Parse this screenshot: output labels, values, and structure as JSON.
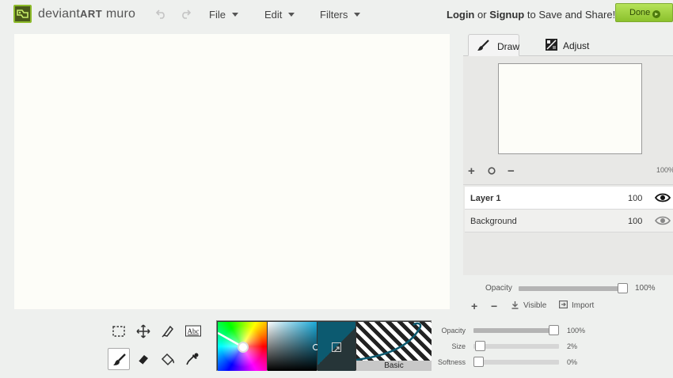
{
  "app": {
    "brand_regular": "deviant",
    "brand_bold": "ART",
    "brand_suffix": " muro"
  },
  "menu": {
    "file": "File",
    "edit": "Edit",
    "filters": "Filters"
  },
  "account": {
    "login": "Login",
    "or": "or",
    "signup": "Signup",
    "suffix": "to Save and Share!",
    "done": "Done"
  },
  "tabs": {
    "draw": "Draw",
    "adjust": "Adjust"
  },
  "preview": {
    "zoom": "100%"
  },
  "layers": [
    {
      "name": "Layer 1",
      "opacity": "100"
    },
    {
      "name": "Background",
      "opacity": "100"
    }
  ],
  "layer_opacity": {
    "label": "Opacity",
    "value": "100%",
    "level": 1.0
  },
  "layer_actions": {
    "visible": "Visible",
    "import": "Import"
  },
  "brush": {
    "preset": "Basic",
    "opacity": {
      "label": "Opacity",
      "value": "100%",
      "level": 1.0
    },
    "size": {
      "label": "Size",
      "value": "2%",
      "level": 0.02
    },
    "softness": {
      "label": "Softness",
      "value": "0%",
      "level": 0.0
    }
  },
  "colors": {
    "accent": "#8bc12c",
    "canvas": "#fdfdf8",
    "primary": "#0c5a70",
    "secondary": "#263538"
  },
  "icons": {
    "logo": "deviantart-logo-icon",
    "undo": "undo-icon",
    "redo": "redo-icon",
    "draw_tab": "brush-icon",
    "adjust_tab": "adjust-icon",
    "layer_visible": "eye-icon"
  }
}
